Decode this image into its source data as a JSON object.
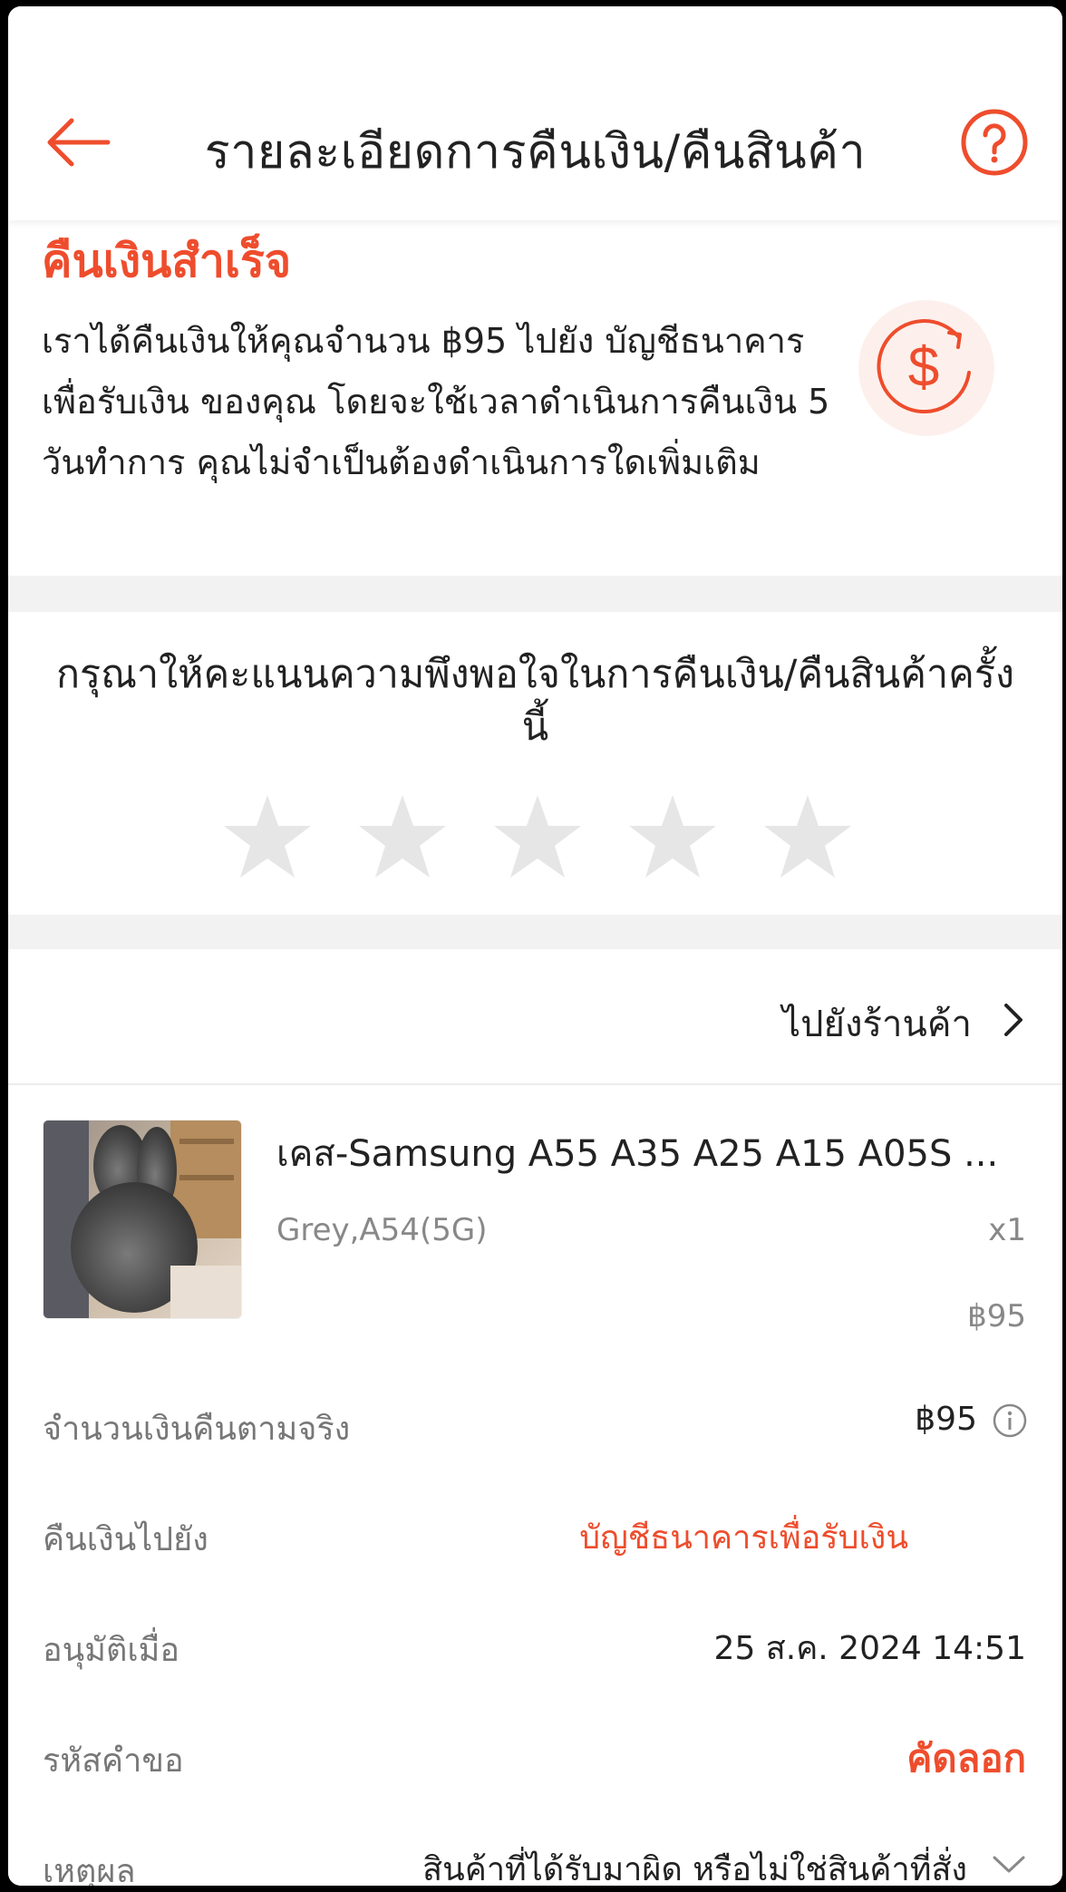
{
  "header": {
    "title": "รายละเอียดการคืนเงิน/คืนสินค้า"
  },
  "status": {
    "title": "คืนเงินสำเร็จ",
    "description": "เราได้คืนเงินให้คุณจำนวน ฿95 ไปยัง บัญชีธนาคารเพื่อรับเงิน ของคุณ โดยจะใช้เวลาดำเนินการคืนเงิน 5 วันทำการ คุณไม่จำเป็นต้องดำเนินการใดเพิ่มเติม"
  },
  "rating": {
    "prompt": "กรุณาให้คะแนนความพึงพอใจในการคืนเงิน/คืนสินค้าครั้งนี้",
    "stars_filled": 0,
    "stars_total": 5
  },
  "shop": {
    "link_label": "ไปยังร้านค้า"
  },
  "product": {
    "name": "เคส-Samsung A55 A35 A25 A15 A05S ...",
    "variant": "Grey,A54(5G)",
    "quantity": "x1",
    "price": "฿95"
  },
  "details": {
    "actual_refund_label": "จำนวนเงินคืนตามจริง",
    "actual_refund_value": "฿95",
    "refund_to_label": "คืนเงินไปยัง",
    "refund_to_value": "บัญชีธนาคารเพื่อรับเงิน",
    "approved_label": "อนุมัติเมื่อ",
    "approved_value": "25 ส.ค. 2024 14:51",
    "request_id_label": "รหัสคำขอ",
    "copy_label": "คัดลอก",
    "reason_label": "เหตุผล",
    "reason_value": "สินค้าที่ได้รับมาผิด หรือไม่ใช่สินค้าที่สั่ง"
  },
  "colors": {
    "accent": "#ee4d2d",
    "star_empty": "#e6e6e6",
    "section_gap": "#f2f2f2"
  },
  "icons": {
    "back": "arrow-left-icon",
    "help": "question-circle-icon",
    "refund": "dollar-refresh-icon",
    "star": "star-icon",
    "chevron_right": "chevron-right-icon",
    "info": "info-circle-icon",
    "chevron_down": "chevron-down-icon"
  }
}
